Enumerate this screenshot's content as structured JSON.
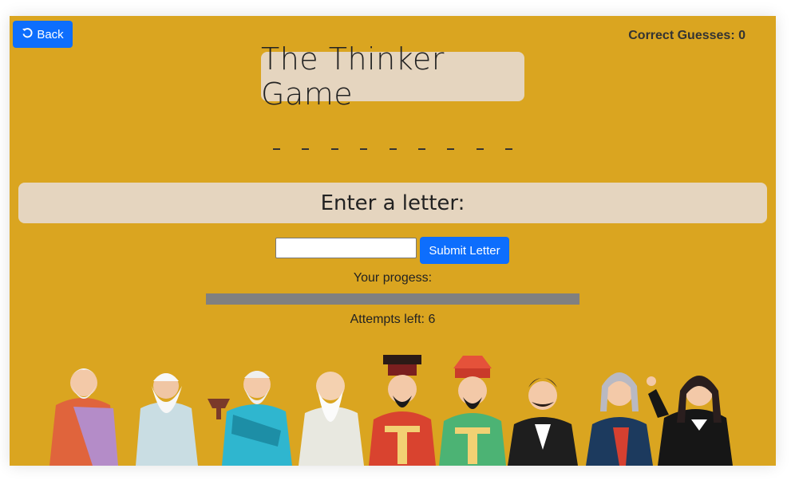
{
  "header": {
    "back_label": "Back",
    "back_icon": "rotate-left-icon",
    "score_label": "Correct Guesses:",
    "score_value": "0"
  },
  "title": "The Thinker Game",
  "word": {
    "blanks": [
      "_",
      "_",
      "_",
      "_",
      "_",
      "_",
      "_",
      "_",
      "_"
    ]
  },
  "prompt": "Enter a letter:",
  "input": {
    "value": "",
    "placeholder": ""
  },
  "submit_label": "Submit Letter",
  "progress": {
    "label": "Your progess:",
    "fraction": 0
  },
  "attempts": {
    "label": "Attempts left:",
    "value": "6"
  },
  "colors": {
    "background": "#daa520",
    "panel": "#e5d5bf",
    "button": "#0d6efd",
    "progress_track": "#808080"
  }
}
